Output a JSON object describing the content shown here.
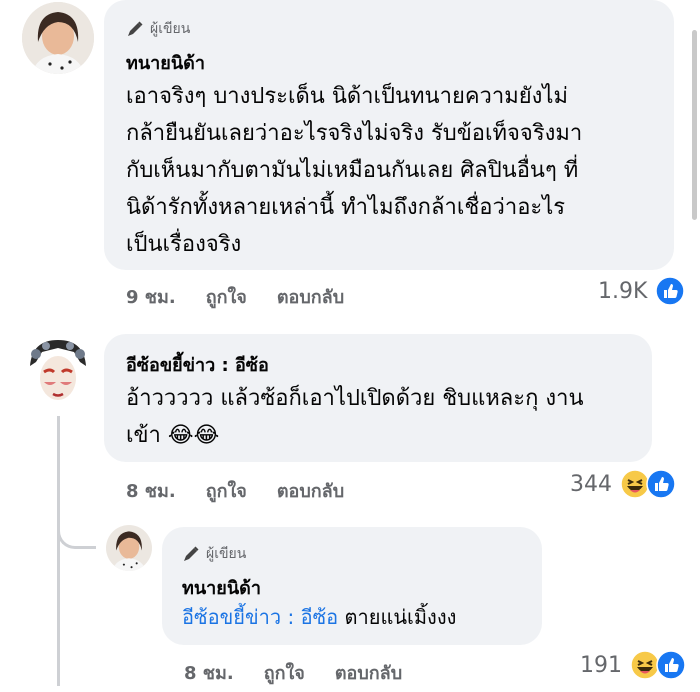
{
  "comments": [
    {
      "badge": "ผู้เขียน",
      "name": "ทนายนิด้า",
      "text_lines": [
        "เอาจริงๆ บางประเด็น นิด้าเป็นทนายความยังไม่",
        "กล้ายืนยันเลยว่าอะไรจริงไม่จริง รับข้อเท็จจริงมา",
        "กับเห็นมากับตามันไม่เหมือนกันเลย ศิลปินอื่นๆ ที่",
        "นิด้ารักทั้งหลายเหล่านี้ ทำไมถึงกล้าเชื่อว่าอะไร",
        "เป็นเรื่องจริง"
      ],
      "time": "9 ชม.",
      "like": "ถูกใจ",
      "reply": "ตอบกลับ",
      "reaction_count": "1.9K",
      "reaction_icon": "like-icon"
    },
    {
      "name": "อีซ้อขยี้ข่าว : อีซ้อ",
      "text_line1": "อ้าววววว แล้วซ้อก็เอาไปเปิดด้วย ชิบแหละกุ งาน",
      "text_line2": "เข้า",
      "emoji": "😂😂",
      "time": "8 ชม.",
      "like": "ถูกใจ",
      "reply": "ตอบกลับ",
      "reaction_count": "344",
      "reaction_icons": [
        "haha-icon",
        "like-icon"
      ]
    },
    {
      "badge": "ผู้เขียน",
      "name": "ทนายนิด้า",
      "mention": "อีซ้อขยี้ข่าว : อีซ้อ",
      "text": "ตายแน่เมิ้งงง",
      "time": "8 ชม.",
      "like": "ถูกใจ",
      "reply": "ตอบกลับ",
      "reaction_count": "191",
      "reaction_icons": [
        "haha-icon",
        "like-icon"
      ]
    }
  ],
  "colors": {
    "bubble": "#f0f2f5",
    "like_blue": "#1877f2",
    "haha_yellow": "#f7c948",
    "meta_gray": "#65676b",
    "mention_blue": "#1b74e4"
  }
}
